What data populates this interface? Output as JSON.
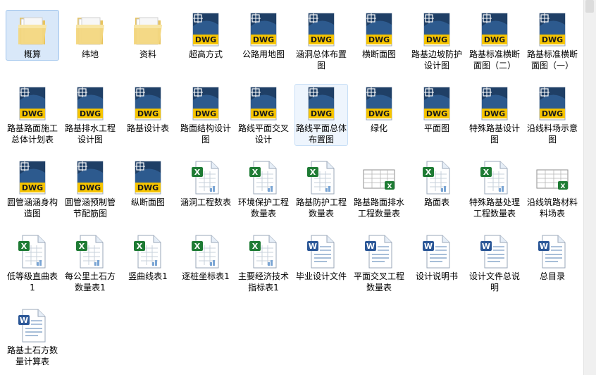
{
  "items": [
    {
      "label": "概算",
      "type": "folder",
      "state": "selected"
    },
    {
      "label": "纬地",
      "type": "folder"
    },
    {
      "label": "资料",
      "type": "folder"
    },
    {
      "label": "超高方式",
      "type": "dwg"
    },
    {
      "label": "公路用地图",
      "type": "dwg"
    },
    {
      "label": "涵洞总体布置图",
      "type": "dwg"
    },
    {
      "label": "横断面图",
      "type": "dwg"
    },
    {
      "label": "路基边坡防护设计图",
      "type": "dwg"
    },
    {
      "label": "路基标准横断面图（二）",
      "type": "dwg"
    },
    {
      "label": "路基标准横断面图（一）",
      "type": "dwg"
    },
    {
      "label": "路基路面施工总体计划表",
      "type": "dwg"
    },
    {
      "label": "路基排水工程设计图",
      "type": "dwg"
    },
    {
      "label": "路基设计表",
      "type": "dwg"
    },
    {
      "label": "路面结构设计图",
      "type": "dwg"
    },
    {
      "label": "路线平面交叉设计",
      "type": "dwg"
    },
    {
      "label": "路线平面总体布置图",
      "type": "dwg",
      "state": "hover"
    },
    {
      "label": "绿化",
      "type": "dwg"
    },
    {
      "label": "平面图",
      "type": "dwg"
    },
    {
      "label": "特殊路基设计图",
      "type": "dwg"
    },
    {
      "label": "沿线料场示意图",
      "type": "dwg"
    },
    {
      "label": "圆管涵涵身构造图",
      "type": "dwg"
    },
    {
      "label": "圆管涵预制管节配筋图",
      "type": "dwg"
    },
    {
      "label": "纵断面图",
      "type": "dwg"
    },
    {
      "label": "涵洞工程数表",
      "type": "xls"
    },
    {
      "label": "环境保护工程数量表",
      "type": "xls"
    },
    {
      "label": "路基防护工程数量表",
      "type": "xls"
    },
    {
      "label": "路基路面排水工程数量表",
      "type": "xls-thumb"
    },
    {
      "label": "路面表",
      "type": "xls"
    },
    {
      "label": "特殊路基处理工程数量表",
      "type": "xls"
    },
    {
      "label": "沿线筑路材料料场表",
      "type": "xls-thumb"
    },
    {
      "label": "低等级直曲表1",
      "type": "xls"
    },
    {
      "label": "每公里土石方数量表1",
      "type": "xls"
    },
    {
      "label": "竖曲线表1",
      "type": "xls"
    },
    {
      "label": "逐桩坐标表1",
      "type": "xls"
    },
    {
      "label": "主要经济技术指标表1",
      "type": "xls"
    },
    {
      "label": "毕业设计文件",
      "type": "doc"
    },
    {
      "label": "平面交叉工程数量表",
      "type": "doc"
    },
    {
      "label": "设计说明书",
      "type": "doc"
    },
    {
      "label": "设计文件总说明",
      "type": "doc"
    },
    {
      "label": "总目录",
      "type": "doc"
    },
    {
      "label": "路基土石方数量计算表",
      "type": "doc"
    }
  ],
  "icon_text": {
    "dwg": "DWG"
  },
  "colors": {
    "selected_bg": "#d9e8f9",
    "folder": "#f2d27a",
    "dwg_dark": "#1f3f66",
    "dwg_yellow": "#f5c400",
    "excel_green": "#1e7b34",
    "word_blue": "#2b5797"
  }
}
